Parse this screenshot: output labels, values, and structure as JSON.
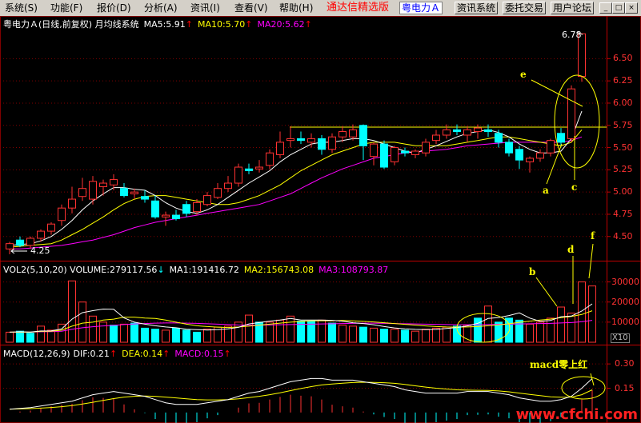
{
  "menu": {
    "items": [
      "系统(S)",
      "功能(F)",
      "报价(D)",
      "分析(A)",
      "资讯(I)",
      "查看(V)",
      "帮助(H)"
    ],
    "brand": "通达信精选版",
    "stock": "粤电力Ａ",
    "buttons": [
      "资讯系统",
      "委托交易",
      "用户论坛"
    ],
    "window_controls": [
      "_",
      "□",
      "×"
    ]
  },
  "price_header": {
    "title": "粤电力Ａ(日线,前复权) 月均线系统",
    "ma5": "MA5:5.91",
    "ma10": "MA10:5.70",
    "ma20": "MA20:5.62"
  },
  "volume_header": {
    "title": "VOL2(5,10,20) VOLUME:279117.56",
    "ma1": "MA1:191416.72",
    "ma2": "MA2:156743.08",
    "ma3": "MA3:108793.87"
  },
  "macd_header": {
    "title": "MACD(12,26,9)",
    "dif": "DIF:0.21",
    "dea": "DEA:0.14",
    "macd": "MACD:0.15"
  },
  "price_axis": [
    "6.50",
    "6.25",
    "6.00",
    "5.75",
    "5.50",
    "5.25",
    "5.00",
    "4.75",
    "4.50"
  ],
  "volume_axis": [
    "30000",
    "20000",
    "10000"
  ],
  "volume_unit": "X10",
  "macd_axis": [
    "0.30",
    "0.15"
  ],
  "annotations": {
    "max_price": "6.78",
    "min_price": "4.25",
    "a": "a",
    "b": "b",
    "c": "c",
    "d": "d",
    "e": "e",
    "f": "f",
    "macd_note": "macd零上红"
  },
  "watermark": "www.cfchi.com",
  "colors": {
    "up": "#ff3232",
    "down": "#00ffff",
    "ma5": "#ffffff",
    "ma10": "#ffff00",
    "ma20": "#ff00ff",
    "grid": "#800000",
    "axis_text": "#ff3232",
    "annotation": "#ffff00"
  },
  "chart_data": [
    {
      "type": "candlestick",
      "ylim": [
        4.3,
        6.8
      ],
      "candles": [
        {
          "o": 4.36,
          "h": 4.44,
          "l": 4.3,
          "c": 4.42
        },
        {
          "o": 4.46,
          "h": 4.5,
          "l": 4.38,
          "c": 4.4
        },
        {
          "o": 4.4,
          "h": 4.5,
          "l": 4.36,
          "c": 4.48
        },
        {
          "o": 4.48,
          "h": 4.58,
          "l": 4.44,
          "c": 4.56
        },
        {
          "o": 4.56,
          "h": 4.66,
          "l": 4.52,
          "c": 4.64
        },
        {
          "o": 4.68,
          "h": 4.86,
          "l": 4.62,
          "c": 4.82
        },
        {
          "o": 4.82,
          "h": 5.06,
          "l": 4.76,
          "c": 4.92
        },
        {
          "o": 4.95,
          "h": 5.16,
          "l": 4.9,
          "c": 5.04
        },
        {
          "o": 4.92,
          "h": 5.18,
          "l": 4.86,
          "c": 5.12
        },
        {
          "o": 5.06,
          "h": 5.14,
          "l": 4.96,
          "c": 5.1
        },
        {
          "o": 5.08,
          "h": 5.2,
          "l": 5.02,
          "c": 5.14
        },
        {
          "o": 5.04,
          "h": 5.1,
          "l": 4.94,
          "c": 4.96
        },
        {
          "o": 4.98,
          "h": 5.04,
          "l": 4.92,
          "c": 5.0
        },
        {
          "o": 4.95,
          "h": 5.02,
          "l": 4.88,
          "c": 4.92
        },
        {
          "o": 4.9,
          "h": 4.96,
          "l": 4.7,
          "c": 4.72
        },
        {
          "o": 4.72,
          "h": 4.78,
          "l": 4.62,
          "c": 4.74
        },
        {
          "o": 4.74,
          "h": 4.8,
          "l": 4.68,
          "c": 4.7
        },
        {
          "o": 4.86,
          "h": 4.9,
          "l": 4.72,
          "c": 4.76
        },
        {
          "o": 4.78,
          "h": 4.92,
          "l": 4.74,
          "c": 4.88
        },
        {
          "o": 4.86,
          "h": 5.0,
          "l": 4.84,
          "c": 4.96
        },
        {
          "o": 4.94,
          "h": 5.1,
          "l": 4.92,
          "c": 5.04
        },
        {
          "o": 5.04,
          "h": 5.18,
          "l": 5.0,
          "c": 5.1
        },
        {
          "o": 5.1,
          "h": 5.32,
          "l": 5.06,
          "c": 5.28
        },
        {
          "o": 5.26,
          "h": 5.32,
          "l": 5.2,
          "c": 5.24
        },
        {
          "o": 5.26,
          "h": 5.36,
          "l": 5.22,
          "c": 5.28
        },
        {
          "o": 5.3,
          "h": 5.48,
          "l": 5.26,
          "c": 5.44
        },
        {
          "o": 5.42,
          "h": 5.68,
          "l": 5.38,
          "c": 5.56
        },
        {
          "o": 5.58,
          "h": 5.74,
          "l": 5.5,
          "c": 5.6
        },
        {
          "o": 5.6,
          "h": 5.68,
          "l": 5.54,
          "c": 5.58
        },
        {
          "o": 5.56,
          "h": 5.66,
          "l": 5.5,
          "c": 5.6
        },
        {
          "o": 5.6,
          "h": 5.64,
          "l": 5.42,
          "c": 5.48
        },
        {
          "o": 5.48,
          "h": 5.66,
          "l": 5.44,
          "c": 5.62
        },
        {
          "o": 5.62,
          "h": 5.74,
          "l": 5.56,
          "c": 5.68
        },
        {
          "o": 5.62,
          "h": 5.76,
          "l": 5.58,
          "c": 5.7
        },
        {
          "o": 5.75,
          "h": 5.76,
          "l": 5.36,
          "c": 5.52
        },
        {
          "o": 5.4,
          "h": 5.56,
          "l": 5.3,
          "c": 5.54
        },
        {
          "o": 5.54,
          "h": 5.58,
          "l": 5.26,
          "c": 5.28
        },
        {
          "o": 5.34,
          "h": 5.52,
          "l": 5.3,
          "c": 5.5
        },
        {
          "o": 5.46,
          "h": 5.5,
          "l": 5.4,
          "c": 5.44
        },
        {
          "o": 5.42,
          "h": 5.48,
          "l": 5.38,
          "c": 5.46
        },
        {
          "o": 5.44,
          "h": 5.6,
          "l": 5.4,
          "c": 5.56
        },
        {
          "o": 5.58,
          "h": 5.7,
          "l": 5.54,
          "c": 5.64
        },
        {
          "o": 5.64,
          "h": 5.76,
          "l": 5.6,
          "c": 5.7
        },
        {
          "o": 5.7,
          "h": 5.76,
          "l": 5.64,
          "c": 5.68
        },
        {
          "o": 5.64,
          "h": 5.74,
          "l": 5.56,
          "c": 5.7
        },
        {
          "o": 5.68,
          "h": 5.76,
          "l": 5.6,
          "c": 5.72
        },
        {
          "o": 5.7,
          "h": 5.76,
          "l": 5.62,
          "c": 5.68
        },
        {
          "o": 5.66,
          "h": 5.7,
          "l": 5.5,
          "c": 5.56
        },
        {
          "o": 5.56,
          "h": 5.6,
          "l": 5.4,
          "c": 5.44
        },
        {
          "o": 5.48,
          "h": 5.52,
          "l": 5.26,
          "c": 5.36
        },
        {
          "o": 5.34,
          "h": 5.4,
          "l": 5.22,
          "c": 5.38
        },
        {
          "o": 5.38,
          "h": 5.48,
          "l": 5.34,
          "c": 5.44
        },
        {
          "o": 5.44,
          "h": 5.6,
          "l": 5.4,
          "c": 5.58
        },
        {
          "o": 5.66,
          "h": 5.72,
          "l": 5.5,
          "c": 5.56
        },
        {
          "o": 5.6,
          "h": 6.2,
          "l": 5.56,
          "c": 6.16
        },
        {
          "o": 6.3,
          "h": 6.78,
          "l": 6.24,
          "c": 6.78
        }
      ],
      "ma5": [
        4.4,
        4.41,
        4.42,
        4.45,
        4.5,
        4.58,
        4.68,
        4.8,
        4.9,
        4.98,
        5.05,
        5.05,
        5.03,
        5.02,
        4.96,
        4.88,
        4.82,
        4.78,
        4.76,
        4.8,
        4.86,
        4.94,
        5.02,
        5.1,
        5.17,
        5.24,
        5.34,
        5.42,
        5.48,
        5.54,
        5.56,
        5.56,
        5.58,
        5.6,
        5.6,
        5.58,
        5.54,
        5.5,
        5.46,
        5.44,
        5.48,
        5.52,
        5.57,
        5.62,
        5.66,
        5.68,
        5.7,
        5.67,
        5.62,
        5.54,
        5.48,
        5.44,
        5.44,
        5.46,
        5.6,
        5.91
      ],
      "ma10": [
        4.38,
        4.39,
        4.4,
        4.41,
        4.42,
        4.46,
        4.52,
        4.58,
        4.65,
        4.72,
        4.8,
        4.87,
        4.92,
        4.95,
        4.96,
        4.96,
        4.94,
        4.92,
        4.9,
        4.88,
        4.86,
        4.86,
        4.88,
        4.92,
        4.96,
        5.02,
        5.08,
        5.16,
        5.24,
        5.3,
        5.36,
        5.42,
        5.46,
        5.5,
        5.54,
        5.56,
        5.56,
        5.56,
        5.54,
        5.52,
        5.52,
        5.52,
        5.52,
        5.54,
        5.56,
        5.58,
        5.6,
        5.62,
        5.62,
        5.6,
        5.58,
        5.56,
        5.54,
        5.52,
        5.56,
        5.7
      ],
      "ma20": [
        4.36,
        4.36,
        4.37,
        4.38,
        4.39,
        4.4,
        4.42,
        4.44,
        4.46,
        4.49,
        4.52,
        4.56,
        4.6,
        4.63,
        4.66,
        4.68,
        4.7,
        4.72,
        4.74,
        4.76,
        4.78,
        4.8,
        4.82,
        4.84,
        4.86,
        4.9,
        4.94,
        4.98,
        5.04,
        5.1,
        5.16,
        5.21,
        5.26,
        5.3,
        5.34,
        5.38,
        5.4,
        5.42,
        5.44,
        5.45,
        5.46,
        5.47,
        5.48,
        5.5,
        5.52,
        5.53,
        5.54,
        5.55,
        5.56,
        5.56,
        5.56,
        5.56,
        5.56,
        5.56,
        5.58,
        5.62
      ],
      "resistance_line": 5.73
    },
    {
      "type": "bar",
      "title": "VOL2(5,10,20)",
      "ylim": [
        0,
        35000
      ],
      "values": [
        5000,
        5500,
        4500,
        8000,
        6000,
        9000,
        30500,
        20000,
        13000,
        10000,
        8500,
        9000,
        9500,
        7000,
        6500,
        6000,
        7000,
        6000,
        5000,
        6500,
        7500,
        8000,
        10000,
        13500,
        10000,
        10000,
        11000,
        13000,
        10500,
        10500,
        11000,
        9500,
        8500,
        8000,
        7500,
        7000,
        6500,
        6500,
        6000,
        5500,
        6500,
        7000,
        7500,
        8000,
        8500,
        12000,
        18000,
        10000,
        12000,
        11000,
        9000,
        10000,
        12000,
        17500,
        14500,
        30000,
        28000
      ],
      "ma1": [
        5000,
        5200,
        5100,
        5600,
        5700,
        6600,
        11500,
        14700,
        15700,
        16500,
        16400,
        12100,
        10000,
        9000,
        8200,
        7600,
        7200,
        6500,
        6300,
        6100,
        6300,
        6700,
        7400,
        9100,
        9800,
        10500,
        11000,
        11800,
        11000,
        11000,
        11000,
        10900,
        10500,
        9700,
        9300,
        8700,
        7800,
        7100,
        6700,
        6400,
        6300,
        6400,
        6900,
        7300,
        8100,
        9400,
        11800,
        12300,
        13300,
        14600,
        12000,
        10400,
        10800,
        12700,
        13000,
        15500,
        19100
      ],
      "ma2": [
        5000,
        5100,
        5000,
        5400,
        5500,
        6000,
        8000,
        9500,
        10000,
        11000,
        11500,
        12500,
        12500,
        12000,
        11800,
        11000,
        10000,
        9000,
        8200,
        7800,
        7500,
        7300,
        7600,
        8000,
        8500,
        9000,
        9500,
        10000,
        10300,
        10600,
        10700,
        10700,
        10800,
        10600,
        10400,
        10100,
        9700,
        9300,
        8900,
        8500,
        8100,
        7800,
        7600,
        7500,
        7600,
        7800,
        8200,
        8600,
        9200,
        9900,
        10500,
        11000,
        11500,
        12200,
        12800,
        13800,
        15674
      ],
      "ma3": [
        5000,
        5000,
        5000,
        5200,
        5300,
        5500,
        6500,
        7200,
        7700,
        8100,
        8400,
        8800,
        9100,
        9300,
        9500,
        9600,
        9600,
        9500,
        9400,
        9200,
        9000,
        8800,
        8600,
        8500,
        8500,
        8600,
        8700,
        8800,
        8900,
        9000,
        9100,
        9200,
        9300,
        9400,
        9500,
        9500,
        9400,
        9300,
        9200,
        9100,
        9000,
        8900,
        8800,
        8700,
        8700,
        8700,
        8800,
        8900,
        9000,
        9100,
        9200,
        9300,
        9400,
        9600,
        9800,
        10200,
        10879
      ],
      "up": [
        true,
        false,
        false,
        true,
        true,
        true,
        true,
        true,
        true,
        true,
        false,
        true,
        false,
        false,
        false,
        true,
        false,
        false,
        false,
        true,
        true,
        true,
        true,
        true,
        false,
        true,
        true,
        true,
        false,
        false,
        true,
        false,
        true,
        true,
        false,
        true,
        false,
        true,
        false,
        true,
        true,
        true,
        true,
        false,
        true,
        false,
        true,
        false,
        false,
        false,
        true,
        true,
        true,
        true,
        true,
        true,
        true
      ]
    },
    {
      "type": "line",
      "title": "MACD(12,26,9)",
      "ylim": [
        -0.05,
        0.35
      ],
      "dif": [
        0.02,
        0.025,
        0.03,
        0.04,
        0.05,
        0.06,
        0.07,
        0.09,
        0.11,
        0.12,
        0.13,
        0.12,
        0.11,
        0.1,
        0.08,
        0.06,
        0.05,
        0.05,
        0.05,
        0.06,
        0.07,
        0.08,
        0.1,
        0.12,
        0.13,
        0.15,
        0.17,
        0.19,
        0.2,
        0.21,
        0.21,
        0.2,
        0.2,
        0.2,
        0.19,
        0.18,
        0.17,
        0.16,
        0.14,
        0.13,
        0.12,
        0.12,
        0.12,
        0.12,
        0.13,
        0.13,
        0.13,
        0.12,
        0.11,
        0.09,
        0.08,
        0.07,
        0.07,
        0.08,
        0.1,
        0.15,
        0.21
      ],
      "dea": [
        0.02,
        0.022,
        0.024,
        0.027,
        0.031,
        0.036,
        0.043,
        0.052,
        0.063,
        0.075,
        0.086,
        0.095,
        0.1,
        0.102,
        0.1,
        0.095,
        0.09,
        0.085,
        0.08,
        0.078,
        0.078,
        0.08,
        0.085,
        0.092,
        0.1,
        0.11,
        0.122,
        0.135,
        0.148,
        0.16,
        0.17,
        0.176,
        0.181,
        0.185,
        0.187,
        0.186,
        0.184,
        0.18,
        0.173,
        0.165,
        0.157,
        0.15,
        0.145,
        0.14,
        0.138,
        0.137,
        0.136,
        0.133,
        0.128,
        0.12,
        0.112,
        0.104,
        0.097,
        0.094,
        0.095,
        0.11,
        0.14
      ]
    }
  ]
}
